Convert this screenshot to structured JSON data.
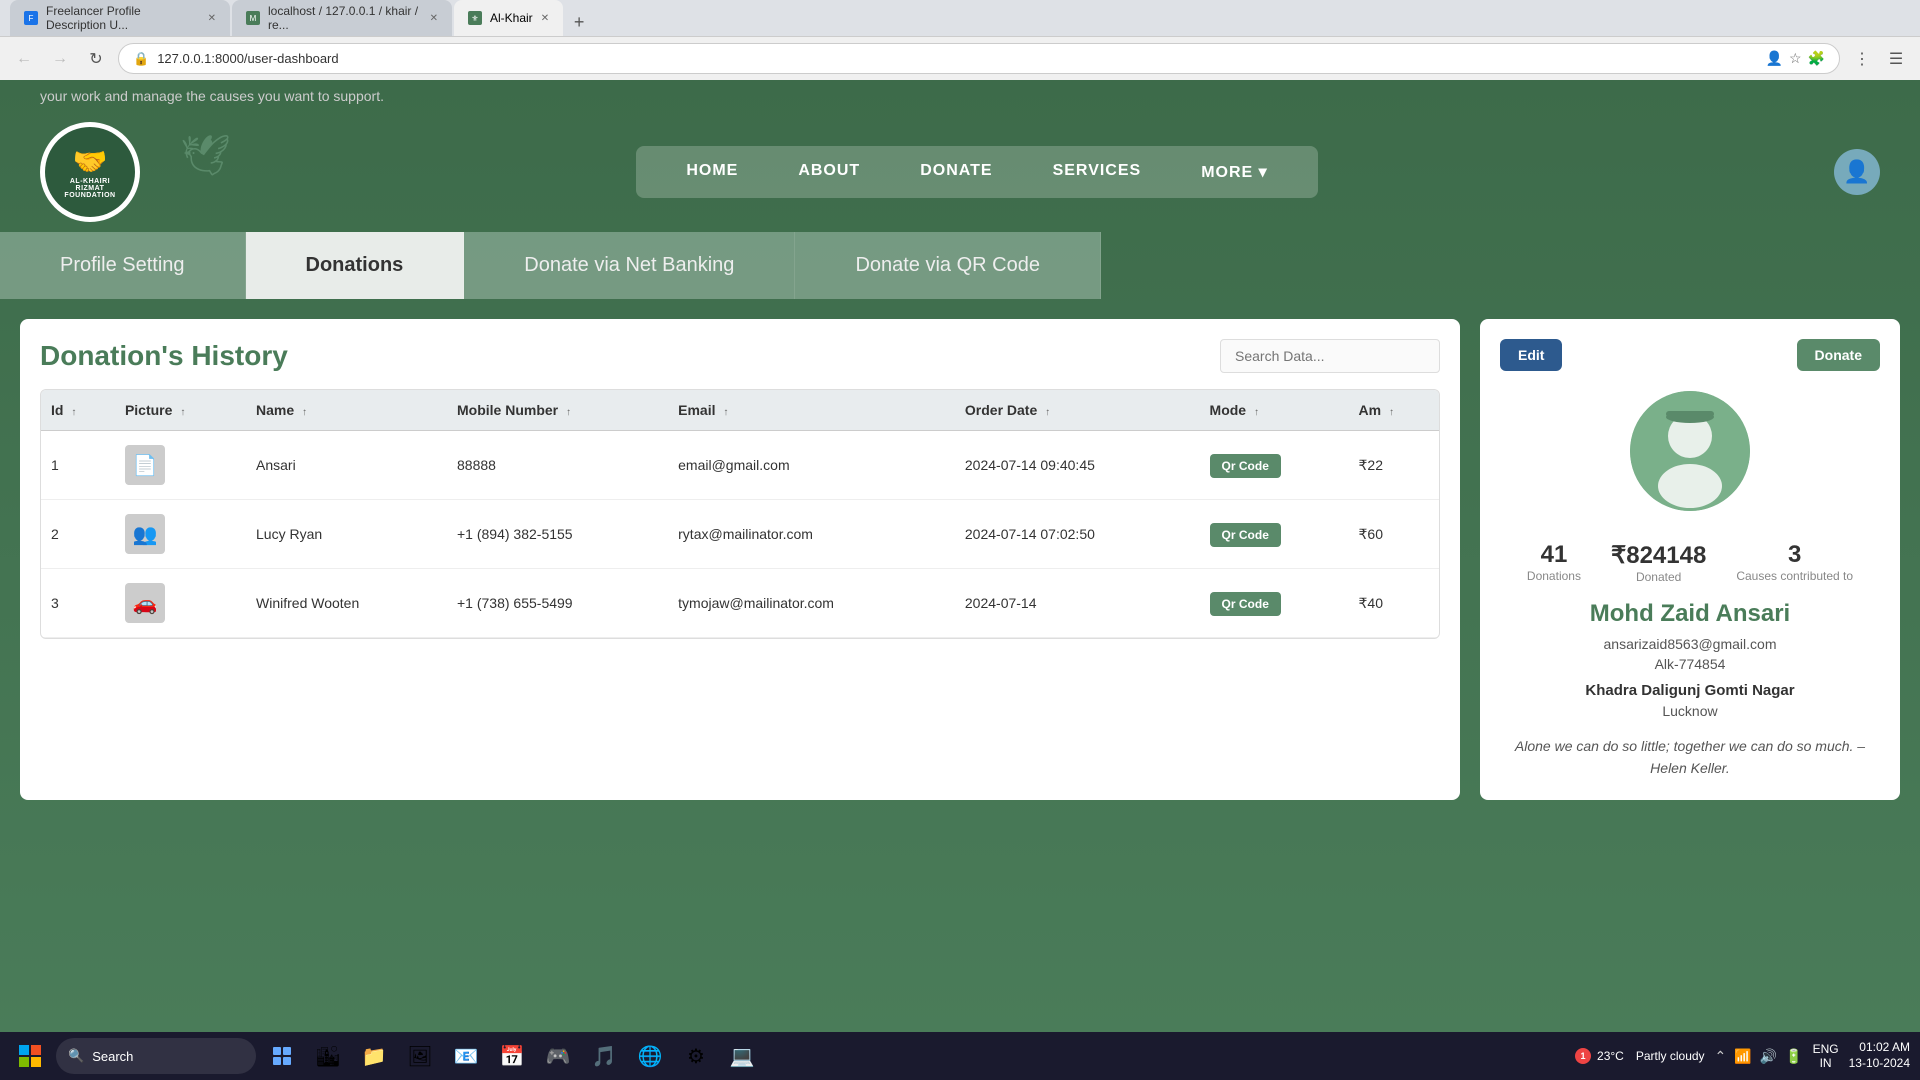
{
  "browser": {
    "tabs": [
      {
        "label": "Freelancer Profile Description U...",
        "active": false,
        "favicon": "F"
      },
      {
        "label": "localhost / 127.0.0.1 / khair / re...",
        "active": false,
        "favicon": "M"
      },
      {
        "label": "Al-Khair",
        "active": true,
        "favicon": "A"
      }
    ],
    "url": "127.0.0.1:8000/user-dashboard",
    "title": "Al-Khair"
  },
  "top_hint": "your work and manage the causes you want to support.",
  "navbar": {
    "logo_text": "AL-KHAIRI\nRIZMAT FOUNDATION",
    "menu_items": [
      "HOME",
      "ABOUT",
      "DONATE",
      "SERVICES",
      "MORE ▾"
    ]
  },
  "tabs": [
    {
      "label": "Profile Setting",
      "active": false
    },
    {
      "label": "Donations",
      "active": true
    },
    {
      "label": "Donate via Net Banking",
      "active": false
    },
    {
      "label": "Donate via QR Code",
      "active": false
    }
  ],
  "left_panel": {
    "title": "Donation's History",
    "search_placeholder": "Search Data...",
    "table": {
      "columns": [
        "Id",
        "Picture",
        "Name",
        "Mobile Number",
        "Email",
        "Order Date",
        "Mode",
        "Am"
      ],
      "rows": [
        {
          "id": "1",
          "picture": "📄",
          "name": "Ansari",
          "mobile": "88888",
          "email": "email@gmail.com",
          "order_date": "2024-07-14 09:40:45",
          "mode": "Qr Code",
          "amount": "₹22"
        },
        {
          "id": "2",
          "picture": "👥",
          "name": "Lucy Ryan",
          "mobile": "+1 (894) 382-5155",
          "email": "rytax@mailinator.com",
          "order_date": "2024-07-14 07:02:50",
          "mode": "Qr Code",
          "amount": "₹60"
        },
        {
          "id": "3",
          "picture": "🚗",
          "name": "Winifred Wooten",
          "mobile": "+1 (738) 655-5499",
          "email": "tymojaw@mailinator.com",
          "order_date": "2024-07-14",
          "mode": "Qr Code",
          "amount": "₹40"
        }
      ]
    }
  },
  "right_panel": {
    "edit_label": "Edit",
    "donate_label": "Donate",
    "stats": {
      "donations_count": "41",
      "donations_label": "Donations",
      "donated_amount": "₹824148",
      "donated_label": "Donated",
      "causes_count": "3",
      "causes_label": "Causes contributed to"
    },
    "profile": {
      "name": "Mohd Zaid Ansari",
      "email": "ansarizaid8563@gmail.com",
      "id": "Alk-774854",
      "address": "Khadra Daligunj Gomti Nagar",
      "city": "Lucknow",
      "quote": "Alone we can do so little; together we can do so much. – Helen Keller."
    }
  },
  "taskbar": {
    "search_label": "Search",
    "weather": {
      "temp": "23°C",
      "condition": "Partly cloudy"
    },
    "system": {
      "lang": "ENG",
      "region": "IN",
      "time": "01:02 AM",
      "date": "13-10-2024"
    }
  }
}
